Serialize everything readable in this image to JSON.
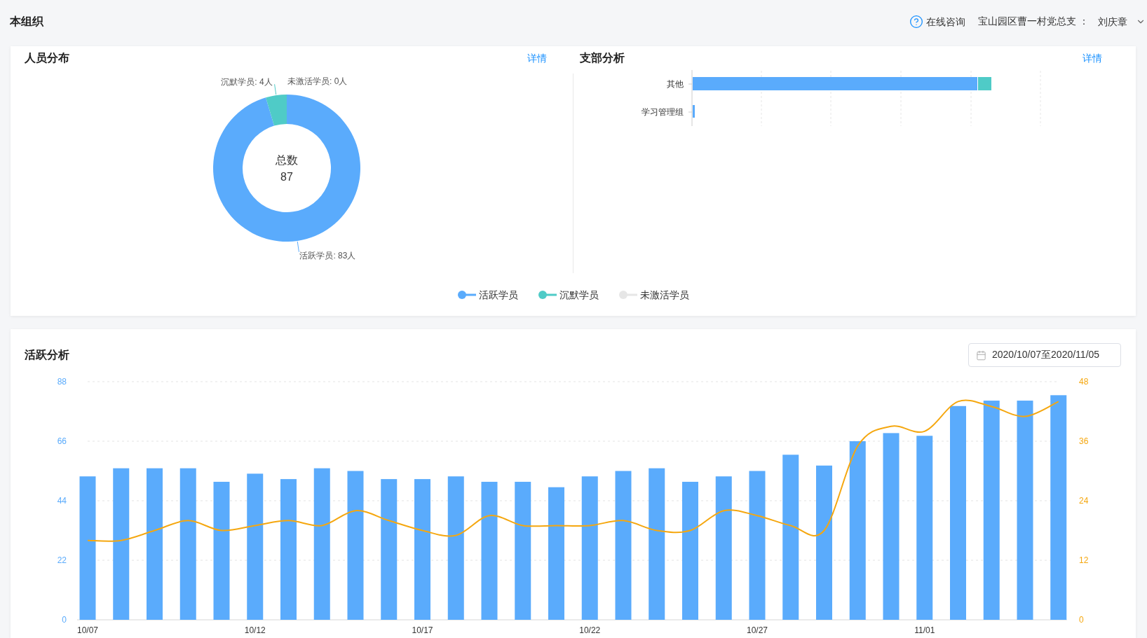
{
  "header": {
    "title": "本组织",
    "help_label": "在线咨询",
    "org_label": "宝山园区曹一村党总支 ：",
    "user_name": "刘庆章"
  },
  "overview": {
    "distribution": {
      "title": "人员分布",
      "detail_link": "详情",
      "center_label": "总数",
      "center_value": "87",
      "chart_data": {
        "type": "donut",
        "values": [
          83,
          4,
          0
        ],
        "value_labels": [
          "活跃学员: 83人",
          "沉默学员: 4人",
          "未激活学员: 0人"
        ]
      }
    },
    "branches": {
      "title": "支部分析",
      "detail_link": "详情",
      "categories": [
        "其他",
        "学习管理组"
      ]
    },
    "legend": [
      {
        "label": "活跃学员",
        "color": "#5aabfc"
      },
      {
        "label": "沉默学员",
        "color": "#4fcbc7"
      },
      {
        "label": "未激活学员",
        "color": "#e6e6e6"
      }
    ]
  },
  "activity": {
    "title": "活跃分析",
    "date_range": "2020/10/07至2020/11/05",
    "chart_data": {
      "type": "bar",
      "grid": true,
      "categories": [
        "10/07",
        null,
        null,
        null,
        null,
        "10/12",
        null,
        null,
        null,
        null,
        "10/17",
        null,
        null,
        null,
        null,
        "10/22",
        null,
        null,
        null,
        null,
        "10/27",
        null,
        null,
        null,
        null,
        "11/01",
        null,
        null,
        null,
        null
      ],
      "ylim": [
        0,
        88
      ],
      "yticks": [
        0,
        22,
        44,
        66,
        88
      ],
      "y2lim": [
        0,
        48
      ],
      "y2ticks": [
        0,
        12,
        24,
        36,
        48
      ],
      "series": [
        {
          "color": "#5aabfc",
          "values": [
            53,
            56,
            56,
            56,
            51,
            54,
            52,
            56,
            55,
            52,
            52,
            53,
            51,
            51,
            49,
            53,
            55,
            56,
            51,
            53,
            55,
            61,
            57,
            66,
            69,
            68,
            79,
            81,
            81,
            83
          ]
        },
        {
          "type": "line",
          "axis": "y2",
          "color": "#f5a70f",
          "values": [
            16,
            16,
            18,
            20,
            18,
            19,
            20,
            19,
            22,
            20,
            18,
            17,
            21,
            19,
            19,
            19,
            20,
            18,
            18,
            22,
            21,
            19,
            18,
            35,
            39,
            38,
            44,
            43,
            41,
            44
          ]
        }
      ]
    }
  }
}
